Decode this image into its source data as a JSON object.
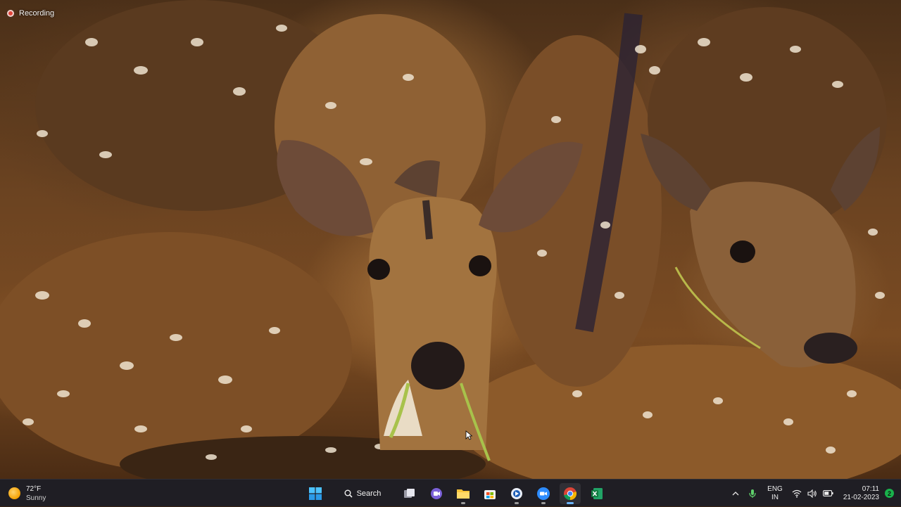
{
  "recording": {
    "label": "Recording"
  },
  "weather": {
    "temperature": "72°F",
    "condition": "Sunny",
    "icon": "sun-icon"
  },
  "taskbar": {
    "search_label": "Search",
    "apps": [
      {
        "name": "start-button",
        "icon": "windows-logo-icon"
      },
      {
        "name": "search-button",
        "icon": "search-icon"
      },
      {
        "name": "task-view-button",
        "icon": "task-view-icon"
      },
      {
        "name": "teams-chat-button",
        "icon": "chat-icon"
      },
      {
        "name": "file-explorer-button",
        "icon": "folder-icon"
      },
      {
        "name": "microsoft-store-button",
        "icon": "store-icon"
      },
      {
        "name": "app-button-blue-circle",
        "icon": "app-icon"
      },
      {
        "name": "zoom-button",
        "icon": "zoom-icon"
      },
      {
        "name": "chrome-button",
        "icon": "chrome-icon",
        "active": true
      },
      {
        "name": "excel-button",
        "icon": "excel-icon"
      }
    ]
  },
  "tray": {
    "language_line1": "ENG",
    "language_line2": "IN",
    "time": "07:11",
    "date": "21-02-2023",
    "notification_count": "2"
  },
  "colors": {
    "taskbar_bg": "#1f1e24",
    "accent_blue": "#6cb6ff",
    "recording_red": "#e0453a",
    "notification_green": "#19b14b"
  }
}
